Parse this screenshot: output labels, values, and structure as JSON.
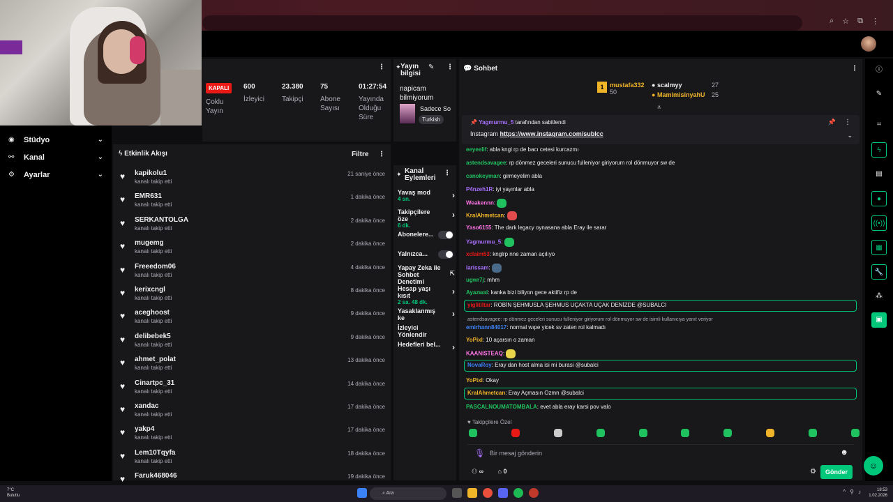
{
  "nav": {
    "items": [
      {
        "label": "Stüdyo",
        "icon": "studio-icon"
      },
      {
        "label": "Kanal",
        "icon": "channel-icon"
      },
      {
        "label": "Ayarlar",
        "icon": "gear-icon"
      }
    ]
  },
  "stats": {
    "status": "KAPALI",
    "status_label": "Çoklu Yayın",
    "viewers": {
      "value": "600",
      "label": "İzleyici"
    },
    "followers": {
      "value": "23.380",
      "label": "Takipçi"
    },
    "subs": {
      "value": "75",
      "label": "Abone Sayısı"
    },
    "uptime": {
      "value": "01:27:54",
      "label": "Yayında Olduğu Süre"
    }
  },
  "stream_info": {
    "header": "Yayın bilgisi",
    "title": "napicam bilmiyorum",
    "category": "Sadece So",
    "tag": "Turkish"
  },
  "activity": {
    "header": "Etkinlik Akışı",
    "filter_label": "Filtre",
    "events": [
      {
        "name": "kapikolu1",
        "sub": "kanalı takip etti",
        "time": "21 saniye önce"
      },
      {
        "name": "EMR631",
        "sub": "kanalı takip etti",
        "time": "1 dakika önce"
      },
      {
        "name": "SERKANTOLGA",
        "sub": "kanalı takip etti",
        "time": "2 dakika önce"
      },
      {
        "name": "mugemg",
        "sub": "kanalı takip etti",
        "time": "2 dakika önce"
      },
      {
        "name": "Freeedom06",
        "sub": "kanalı takip etti",
        "time": "4 dakika önce"
      },
      {
        "name": "kerixcngl",
        "sub": "kanalı takip etti",
        "time": "8 dakika önce"
      },
      {
        "name": "aceghoost",
        "sub": "kanalı takip etti",
        "time": "9 dakika önce"
      },
      {
        "name": "delibebek5",
        "sub": "kanalı takip etti",
        "time": "9 dakika önce"
      },
      {
        "name": "ahmet_polat",
        "sub": "kanalı takip etti",
        "time": "13 dakika önce"
      },
      {
        "name": "Cinartpc_31",
        "sub": "kanalı takip etti",
        "time": "14 dakika önce"
      },
      {
        "name": "xandac",
        "sub": "kanalı takip etti",
        "time": "17 dakika önce"
      },
      {
        "name": "yakp4",
        "sub": "kanalı takip etti",
        "time": "17 dakika önce"
      },
      {
        "name": "Lem10Tqyfa",
        "sub": "kanalı takip etti",
        "time": "18 dakika önce"
      },
      {
        "name": "Faruk468046",
        "sub": "",
        "time": "19 dakika önce"
      }
    ]
  },
  "channel_actions": {
    "header": "Kanal Eylemleri",
    "items": [
      {
        "label": "Yavaş mod",
        "value": "4 sn.",
        "control": "arrow"
      },
      {
        "label": "Takipçilere öze",
        "value": "6 dk.",
        "control": "arrow"
      },
      {
        "label": "Abonelere...",
        "value": "",
        "control": "toggle"
      },
      {
        "label": "Yalnızca...",
        "value": "",
        "control": "toggle"
      },
      {
        "label": "Yapay Zeka ile Sohbet Denetimi",
        "value": "",
        "control": "external"
      },
      {
        "label": "Hesap yaşı kısıt",
        "value": "2 sa. 48 dk.",
        "control": "arrow"
      },
      {
        "label": "Yasaklanmış ke",
        "value": "",
        "control": "arrow"
      },
      {
        "label": "İzleyici Yönlendir",
        "value": "",
        "control": "none"
      },
      {
        "label": "Hedefleri bel...",
        "value": "",
        "control": "arrow"
      }
    ]
  },
  "chat": {
    "header": "Sohbet",
    "leaders": [
      {
        "name": "mustafa332",
        "score": "50"
      },
      {
        "name": "scalmyy",
        "score": "27"
      },
      {
        "name": "MamimisinyahU",
        "score": "25"
      }
    ],
    "pinned": {
      "by": "Yagmurmu_5",
      "by_suffix": "tarafından sabitlendi",
      "text": "Instagram",
      "link": "https://www.instagram.com/sublcc"
    },
    "messages": [
      {
        "user": "eeyeelif",
        "color": "#1fc25f",
        "text": ": abla kngl rp de bacı cetesi kurcazmı"
      },
      {
        "user": "astendsavagee",
        "color": "#1fc25f",
        "text": ": rp dönmez geceleri sunucu fulleniyor giriyorum rol dönmuyor sw de"
      },
      {
        "user": "canokeyman",
        "color": "#1fc25f",
        "text": ": girmeyelim abla"
      },
      {
        "user": "P4nzeh1R",
        "color": "#a970ff",
        "text": ": iyi yayınlar abla"
      },
      {
        "user": "Weakennn",
        "color": "#ff75e6",
        "text": ":"
      },
      {
        "user": "KralAhmetcan",
        "color": "#f0b429",
        "text": ":"
      },
      {
        "user": "Yaso6155",
        "color": "#ff75e6",
        "text": ": The dark legacy oynasana abla Eray ile sarar"
      },
      {
        "user": "Yagmurmu_5",
        "color": "#a970ff",
        "text": ":"
      },
      {
        "user": "xclaim53",
        "color": "#e91916",
        "text": ": knglrp nne zaman açılıyo"
      },
      {
        "user": "larissam",
        "color": "#a970ff",
        "text": ":"
      },
      {
        "user": "ugwr7j",
        "color": "#1fc25f",
        "text": ": mhm"
      },
      {
        "user": "Ayazwai",
        "color": "#1fc25f",
        "text": ": kanka bizi biliyon gece aktifiz rp de"
      },
      {
        "user": "yiglitiltar",
        "color": "#e91916",
        "text": ": ROBİN ŞEHMUSLA ŞEHMUS UÇAKTA UÇAK DENİZDE @SUBALCI"
      },
      {
        "user": "emirhann84017",
        "color": "#3b82f6",
        "text": ": normal wıpe yicek sv zaten rol kalmadı"
      },
      {
        "user": "YoPixl",
        "color": "#f0b429",
        "text": ": 10 açarsın o zaman"
      },
      {
        "user": "KAANISTEAQ",
        "color": "#ff75e6",
        "text": ":"
      },
      {
        "user": "NovaRoy",
        "color": "#3b82f6",
        "text": ": Eray dan host alma isi mi burasi @subalci"
      },
      {
        "user": "YoPixl",
        "color": "#f0b429",
        "text": ": Okay"
      },
      {
        "user": "KralAhmetcan",
        "color": "#f0b429",
        "text": ": Eray Açmasın Ozmn @subalci"
      },
      {
        "user": "PASCALNOUMATOMBALA",
        "color": "#1fc25f",
        "text": ": evet abla eray karsi pov valo"
      }
    ],
    "reply_text": "astendsavagee: rp dönmez geceleri sunucu fulleniyor giriyorum rol dönmuyor sw de isimli kullanıcıya yanıt veriyor",
    "followers_only": "Takipçilere Özel",
    "input_placeholder": "Bir mesaj gönderin",
    "send_label": "Gönder",
    "viewer_count": "∞",
    "gift_count": "0"
  },
  "taskbar": {
    "weather_temp": "7°C",
    "weather_desc": "Bulutlu",
    "search": "Ara",
    "time": "18:53",
    "date": "1.02.2026"
  }
}
